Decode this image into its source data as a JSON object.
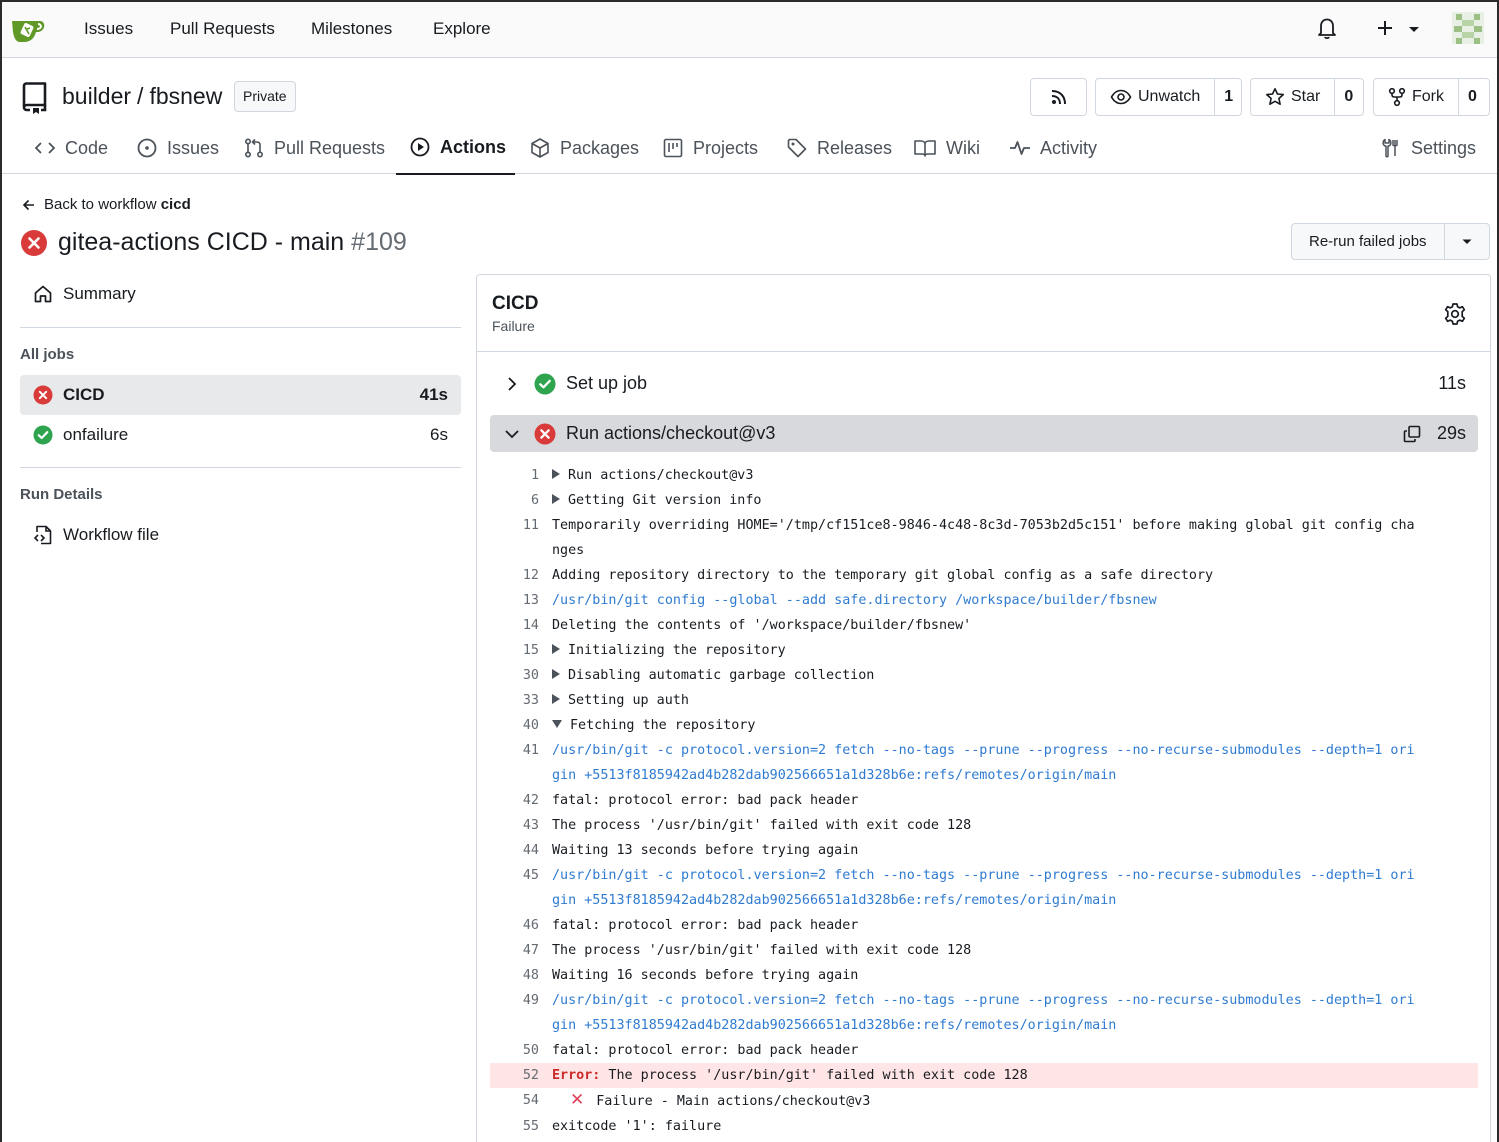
{
  "navbar": {
    "links": [
      "Issues",
      "Pull Requests",
      "Milestones",
      "Explore"
    ]
  },
  "repo": {
    "owner": "builder",
    "separator": "/",
    "name": "fbsnew",
    "visibility": "Private",
    "unwatch_label": "Unwatch",
    "watch_count": "1",
    "star_label": "Star",
    "star_count": "0",
    "fork_label": "Fork",
    "fork_count": "0"
  },
  "tabs": {
    "code": "Code",
    "issues": "Issues",
    "pulls": "Pull Requests",
    "actions": "Actions",
    "packages": "Packages",
    "projects": "Projects",
    "releases": "Releases",
    "wiki": "Wiki",
    "activity": "Activity",
    "settings": "Settings"
  },
  "run": {
    "back_prefix": "Back to workflow",
    "workflow": "cicd",
    "title": "gitea-actions CICD - main",
    "number": "#109",
    "rerun_label": "Re-run failed jobs"
  },
  "sidebar": {
    "summary": "Summary",
    "all_jobs": "All jobs",
    "jobs": [
      {
        "name": "CICD",
        "duration": "41s",
        "status": "failure"
      },
      {
        "name": "onfailure",
        "duration": "6s",
        "status": "success"
      }
    ],
    "run_details": "Run Details",
    "workflow_file": "Workflow file"
  },
  "job": {
    "title": "CICD",
    "status": "Failure",
    "steps": [
      {
        "name": "Set up job",
        "duration": "11s",
        "status": "success"
      },
      {
        "name": "Run actions/checkout@v3",
        "duration": "29s",
        "status": "failure"
      }
    ]
  },
  "log": [
    {
      "n": "1",
      "t": "Run actions/checkout@v3",
      "kind": "group"
    },
    {
      "n": "6",
      "t": "Getting Git version info",
      "kind": "group"
    },
    {
      "n": "11",
      "t": "Temporarily overriding HOME='/tmp/cf151ce8-9846-4c48-8c3d-7053b2d5c151' before making global git config changes",
      "kind": "text"
    },
    {
      "n": "12",
      "t": "Adding repository directory to the temporary git global config as a safe directory",
      "kind": "text"
    },
    {
      "n": "13",
      "t": "/usr/bin/git config --global --add safe.directory /workspace/builder/fbsnew",
      "kind": "cmd"
    },
    {
      "n": "14",
      "t": "Deleting the contents of '/workspace/builder/fbsnew'",
      "kind": "text"
    },
    {
      "n": "15",
      "t": "Initializing the repository",
      "kind": "group"
    },
    {
      "n": "30",
      "t": "Disabling automatic garbage collection",
      "kind": "group"
    },
    {
      "n": "33",
      "t": "Setting up auth",
      "kind": "group"
    },
    {
      "n": "40",
      "t": "Fetching the repository",
      "kind": "group-open"
    },
    {
      "n": "41",
      "t": "/usr/bin/git -c protocol.version=2 fetch --no-tags --prune --progress --no-recurse-submodules --depth=1 origin +5513f8185942ad4b282dab902566651a1d328b6e:refs/remotes/origin/main",
      "kind": "cmd"
    },
    {
      "n": "42",
      "t": "fatal: protocol error: bad pack header",
      "kind": "text"
    },
    {
      "n": "43",
      "t": "The process '/usr/bin/git' failed with exit code 128",
      "kind": "text"
    },
    {
      "n": "44",
      "t": "Waiting 13 seconds before trying again",
      "kind": "text"
    },
    {
      "n": "45",
      "t": "/usr/bin/git -c protocol.version=2 fetch --no-tags --prune --progress --no-recurse-submodules --depth=1 origin +5513f8185942ad4b282dab902566651a1d328b6e:refs/remotes/origin/main",
      "kind": "cmd"
    },
    {
      "n": "46",
      "t": "fatal: protocol error: bad pack header",
      "kind": "text"
    },
    {
      "n": "47",
      "t": "The process '/usr/bin/git' failed with exit code 128",
      "kind": "text"
    },
    {
      "n": "48",
      "t": "Waiting 16 seconds before trying again",
      "kind": "text"
    },
    {
      "n": "49",
      "t": "/usr/bin/git -c protocol.version=2 fetch --no-tags --prune --progress --no-recurse-submodules --depth=1 origin +5513f8185942ad4b282dab902566651a1d328b6e:refs/remotes/origin/main",
      "kind": "cmd"
    },
    {
      "n": "50",
      "t": "fatal: protocol error: bad pack header",
      "kind": "text"
    },
    {
      "n": "52",
      "label": "Error:",
      "t": " The process '/usr/bin/git' failed with exit code 128",
      "kind": "error"
    },
    {
      "n": "54",
      "t": "Failure - Main actions/checkout@v3",
      "kind": "xfail"
    },
    {
      "n": "55",
      "t": "exitcode '1': failure",
      "kind": "text"
    }
  ],
  "colors": {
    "failure": "#d93a3a",
    "success": "#2ea44f",
    "command": "#2f7bd1",
    "error_bg": "#ffe5e5"
  }
}
